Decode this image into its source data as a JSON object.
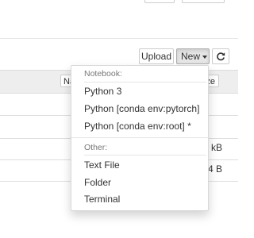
{
  "toolbar": {
    "upload_label": "Upload",
    "new_label": "New",
    "refresh_icon": "refresh-icon"
  },
  "table": {
    "name_header": "Na",
    "size_header": "ze",
    "rows": [
      {
        "size": ""
      },
      {
        "size": ""
      },
      {
        "size": "kB"
      },
      {
        "size": "4 B"
      }
    ]
  },
  "new_menu": {
    "notebook_header": "Notebook:",
    "notebook_items": [
      "Python 3",
      "Python [conda env:pytorch]",
      "Python [conda env:root] *"
    ],
    "other_header": "Other:",
    "other_items": [
      "Text File",
      "Folder",
      "Terminal"
    ]
  },
  "colors": {
    "menu_header": "#777777",
    "divider": "#e5e5e5",
    "active_button": "#e6e6e6"
  }
}
